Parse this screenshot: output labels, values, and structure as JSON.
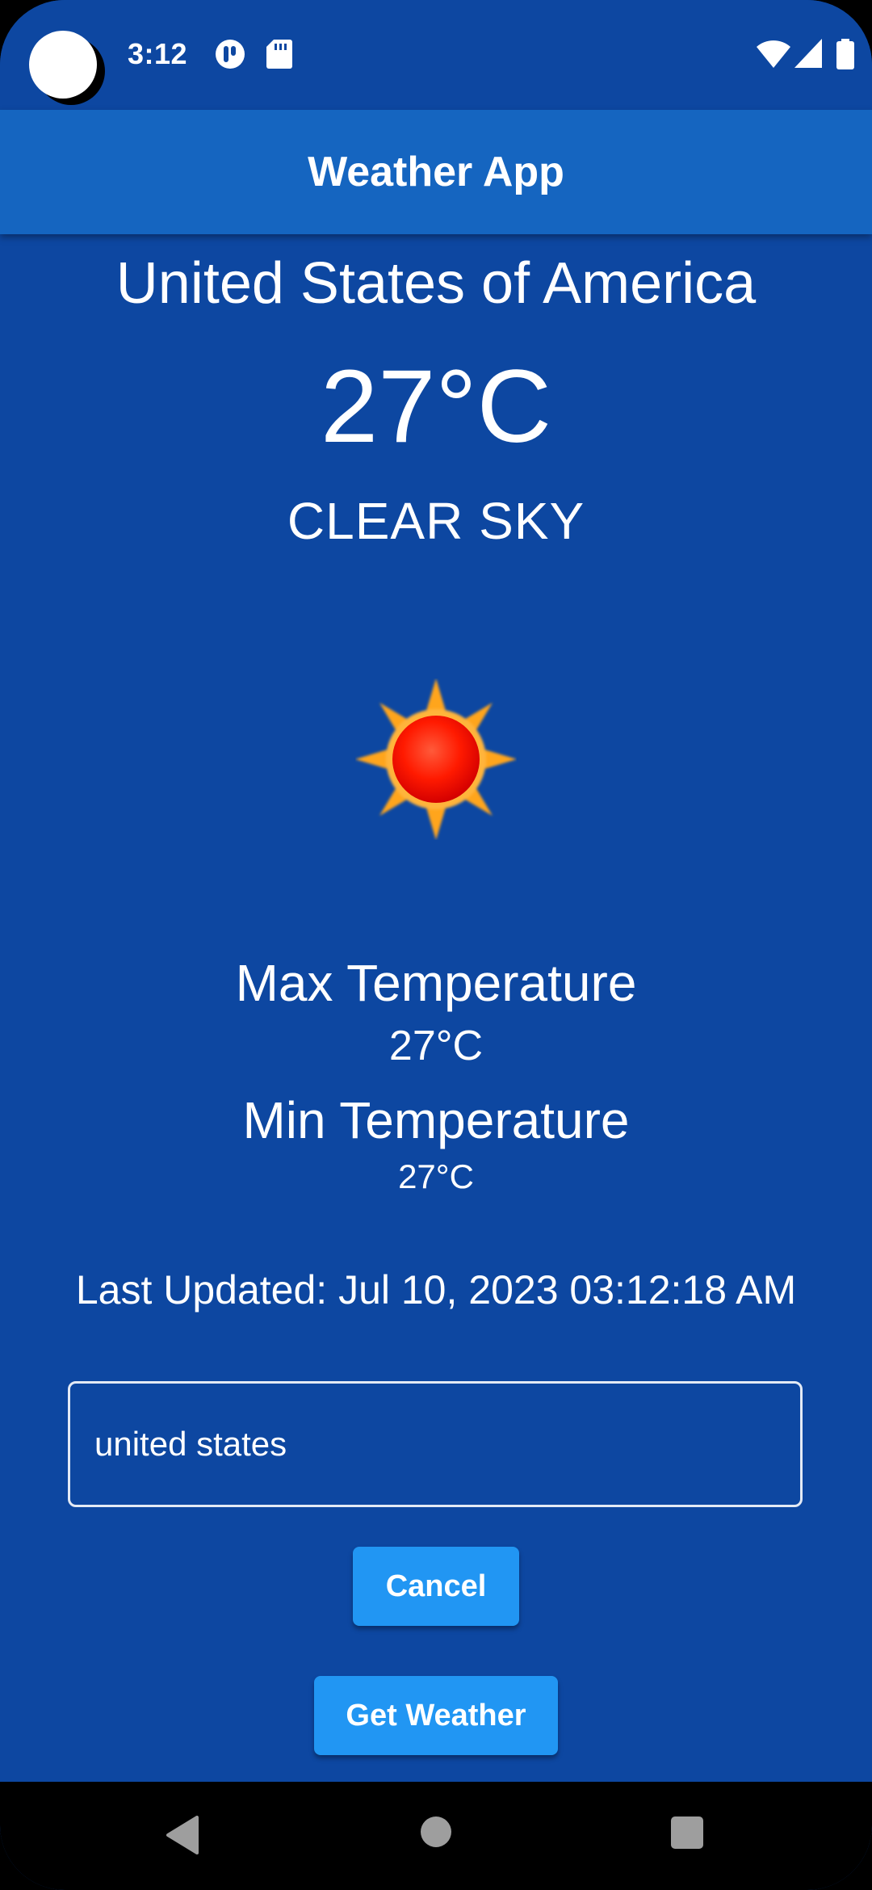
{
  "status_bar": {
    "time": "3:12"
  },
  "app_bar": {
    "title": "Weather App"
  },
  "weather": {
    "country": "United States of America",
    "temperature": "27°C",
    "condition": "CLEAR SKY",
    "icon": "sun-icon",
    "max_label": "Max Temperature",
    "max_value": "27°C",
    "min_label": "Min Temperature",
    "min_value": "27°C",
    "last_updated": "Last Updated: Jul 10, 2023 03:12:18 AM"
  },
  "search": {
    "value": "united states"
  },
  "buttons": {
    "cancel": "Cancel",
    "get_weather": "Get Weather"
  },
  "colors": {
    "background": "#0d47a1",
    "app_bar": "#1565c0",
    "button": "#2196f3"
  }
}
